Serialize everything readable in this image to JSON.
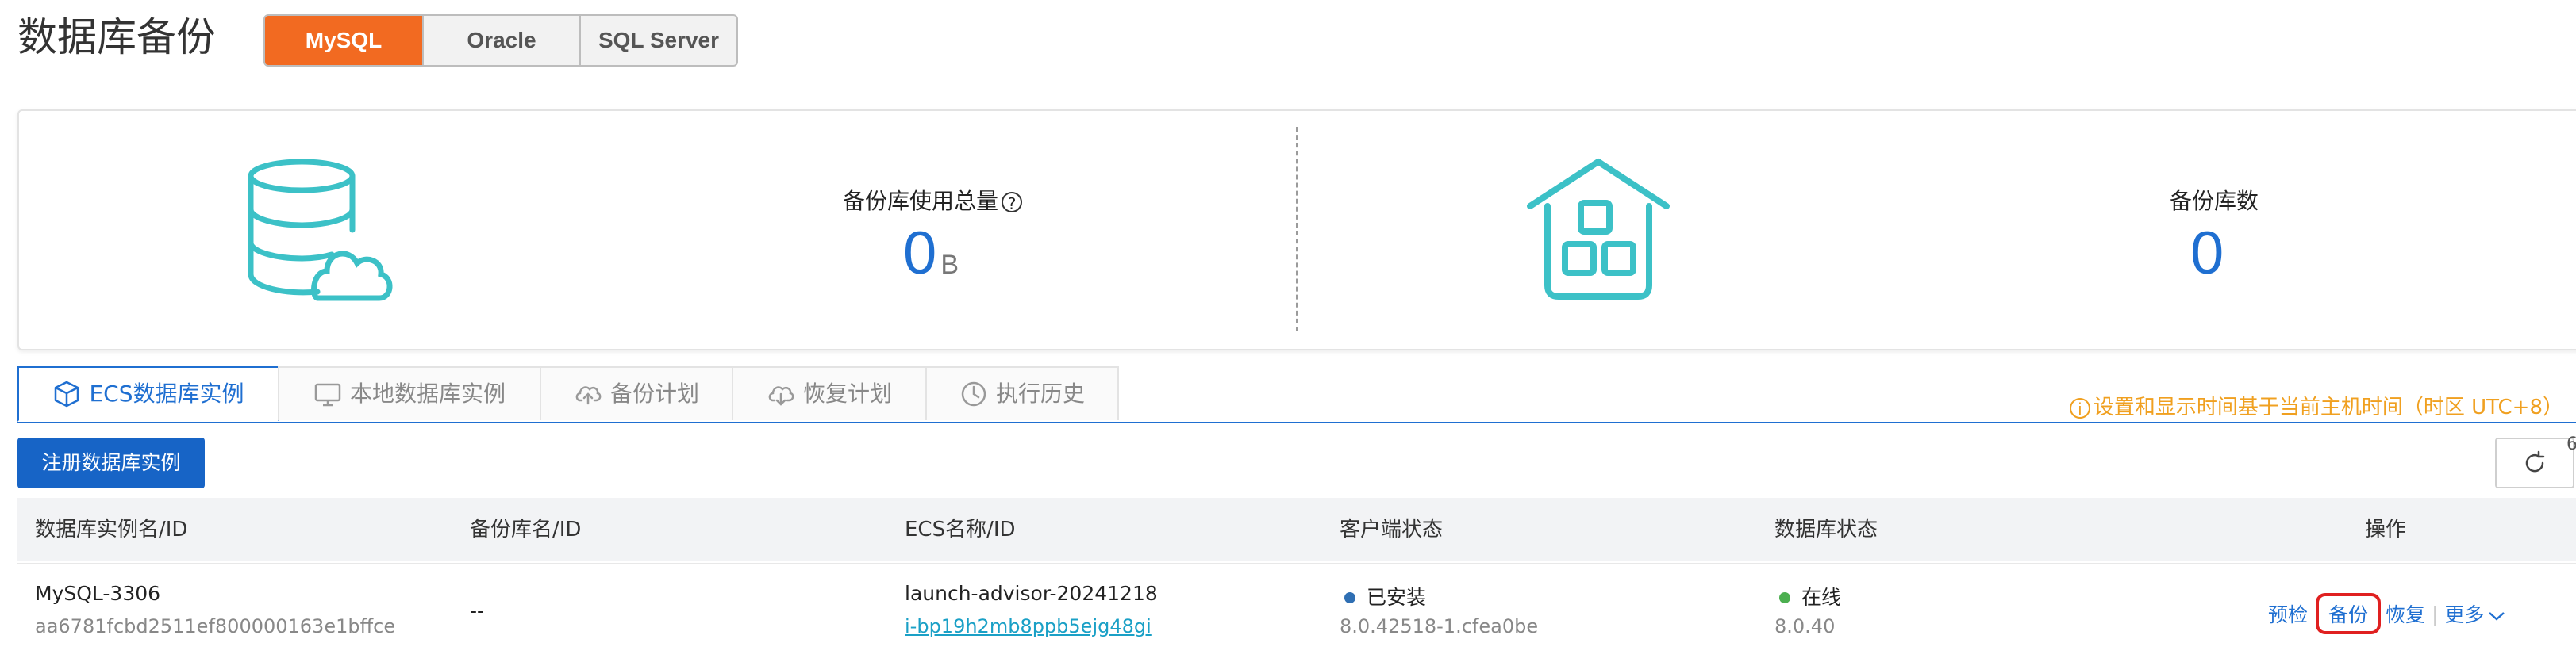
{
  "header": {
    "title": "数据库备份",
    "db_types": [
      "MySQL",
      "Oracle",
      "SQL Server"
    ],
    "active_db_type": "MySQL"
  },
  "summary": {
    "usage_label": "备份库使用总量",
    "usage_value": "0",
    "usage_unit": "B",
    "count_label": "备份库数",
    "count_value": "0"
  },
  "tabs": [
    {
      "label": "ECS数据库实例",
      "icon": "cube-icon",
      "active": true
    },
    {
      "label": "本地数据库实例",
      "icon": "monitor-icon",
      "active": false
    },
    {
      "label": "备份计划",
      "icon": "cloud-upload-icon",
      "active": false
    },
    {
      "label": "恢复计划",
      "icon": "cloud-download-icon",
      "active": false
    },
    {
      "label": "执行历史",
      "icon": "clock-icon",
      "active": false
    }
  ],
  "timezone_note": "设置和显示时间基于当前主机时间（时区 UTC+8）",
  "toolbar": {
    "register_label": "注册数据库实例",
    "refresh_count": "6"
  },
  "table": {
    "columns": [
      "数据库实例名/ID",
      "备份库名/ID",
      "ECS名称/ID",
      "客户端状态",
      "数据库状态",
      "操作"
    ],
    "rows": [
      {
        "instance_name": "MySQL-3306",
        "instance_id": "aa6781fcbd2511ef800000163e1bffce",
        "backup_db": "--",
        "ecs_name": "launch-advisor-20241218",
        "ecs_id": "i-bp19h2mb8ppb5ejg48gi",
        "client_status": "已安装",
        "client_version": "8.0.42518-1.cfea0be",
        "db_status": "在线",
        "db_version": "8.0.40",
        "actions": [
          "预检",
          "备份",
          "恢复",
          "更多"
        ]
      }
    ]
  },
  "colors": {
    "accent": "#f26a21",
    "primary": "#1764c6",
    "link": "#1aa0c6",
    "icon_teal": "#3cc1c7",
    "installed_dot": "#2f6fb3",
    "online_dot": "#4caf50",
    "warning": "#f0a020",
    "highlight": "#e02020"
  }
}
